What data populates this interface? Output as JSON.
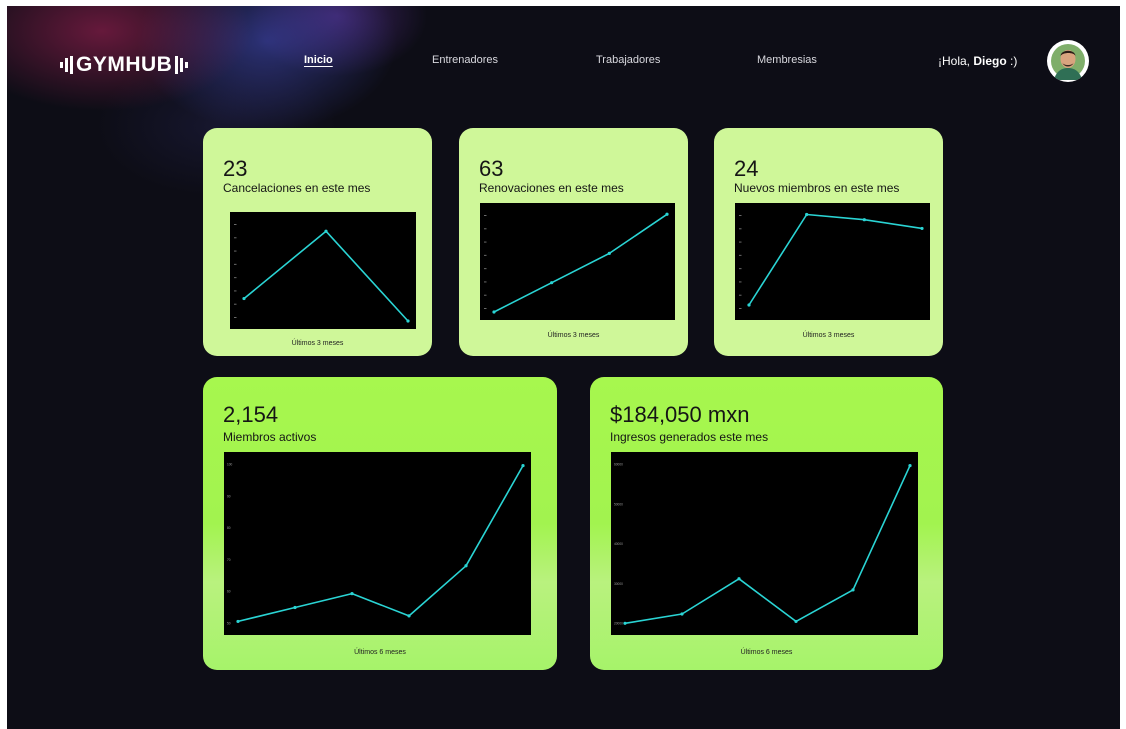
{
  "brand": {
    "name": "GYMHUB"
  },
  "nav": {
    "items": [
      {
        "label": "Inicio",
        "active": true
      },
      {
        "label": "Entrenadores",
        "active": false
      },
      {
        "label": "Trabajadores",
        "active": false
      },
      {
        "label": "Membresias",
        "active": false
      }
    ]
  },
  "user": {
    "greeting_prefix": "¡Hola, ",
    "name": "Diego",
    "greeting_suffix": " :)"
  },
  "colors": {
    "background": "#0d0d16",
    "card_light": "#cff799",
    "card_bright": "#a6f36a",
    "line": "#2ad4d4"
  },
  "cards": [
    {
      "value": "23",
      "label": "Cancelaciones  en este mes",
      "footer": "Últimos 3 meses"
    },
    {
      "value": "63",
      "label": "Renovaciones en este mes",
      "footer": "Últimos 3 meses"
    },
    {
      "value": "24",
      "label": "Nuevos miembros en este mes",
      "footer": "Últimos 3 meses"
    },
    {
      "value": "2,154",
      "label": "Miembros activos",
      "footer": "Últimos 6 meses"
    },
    {
      "value": "$184,050 mxn",
      "label": "Ingresos generados este mes",
      "footer": "Últimos 6 meses"
    }
  ],
  "chart_data": [
    {
      "type": "line",
      "x": [
        1,
        2,
        3
      ],
      "values": [
        32,
        44,
        28
      ],
      "ylim": [
        28,
        46
      ],
      "grid": false,
      "line_color": "#2ad4d4"
    },
    {
      "type": "line",
      "x": [
        1,
        2,
        3,
        4
      ],
      "values": [
        0,
        18,
        36,
        60
      ],
      "ylim": [
        0,
        62
      ],
      "grid": false,
      "line_color": "#2ad4d4"
    },
    {
      "type": "line",
      "x": [
        1,
        2,
        3,
        4
      ],
      "values": [
        2,
        28,
        26.5,
        24
      ],
      "ylim": [
        0,
        29
      ],
      "grid": false,
      "line_color": "#2ad4d4"
    },
    {
      "type": "line",
      "x": [
        1,
        2,
        3,
        4,
        5,
        6
      ],
      "values": [
        62,
        67,
        72,
        64,
        82,
        118
      ],
      "ylim": [
        60,
        120
      ],
      "yticks": [
        "100",
        "90",
        "80",
        "70",
        "60",
        "50"
      ],
      "grid": false,
      "line_color": "#2ad4d4"
    },
    {
      "type": "line",
      "x": [
        1,
        2,
        3,
        4,
        5,
        6
      ],
      "values": [
        22000,
        27000,
        46000,
        23000,
        40000,
        107000
      ],
      "ylim": [
        20000,
        110000
      ],
      "yticks": [
        "60000",
        "50000",
        "40000",
        "30000",
        "20000"
      ],
      "grid": false,
      "line_color": "#2ad4d4"
    }
  ]
}
